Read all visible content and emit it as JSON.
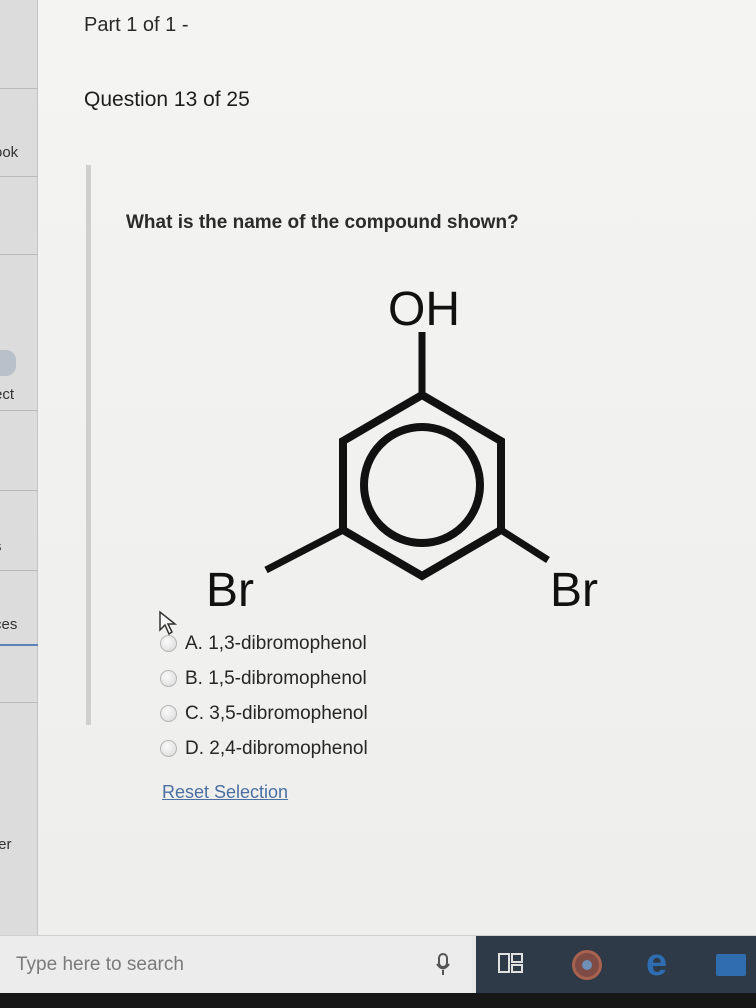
{
  "sidebar": {
    "items": [
      {
        "label": "ook"
      },
      {
        "label": "ect"
      },
      {
        "label": "s"
      },
      {
        "label": "ces"
      },
      {
        "label": "ter"
      }
    ]
  },
  "header": {
    "part_title": "Part 1 of 1 -",
    "question_title": "Question 13 of 25"
  },
  "question": {
    "prompt": "What is the name of the compound shown?",
    "molecule": {
      "labels": {
        "oh": "OH",
        "br_left": "Br",
        "br_right": "Br"
      }
    },
    "choices": [
      {
        "label": "A. 1,3-dibromophenol"
      },
      {
        "label": "B. 1,5-dibromophenol"
      },
      {
        "label": "C. 3,5-dibromophenol"
      },
      {
        "label": "D. 2,4-dibromophenol"
      }
    ],
    "reset_label": "Reset Selection"
  },
  "taskbar": {
    "search_placeholder": "Type here to search",
    "icons": [
      "microphone-icon",
      "task-view-icon",
      "chrome-icon",
      "edge-icon",
      "file-explorer-icon"
    ]
  },
  "colors": {
    "link": "#4a6fa0",
    "taskbar_dark": "#2e3a48",
    "accent_blue": "#2f6db0"
  }
}
